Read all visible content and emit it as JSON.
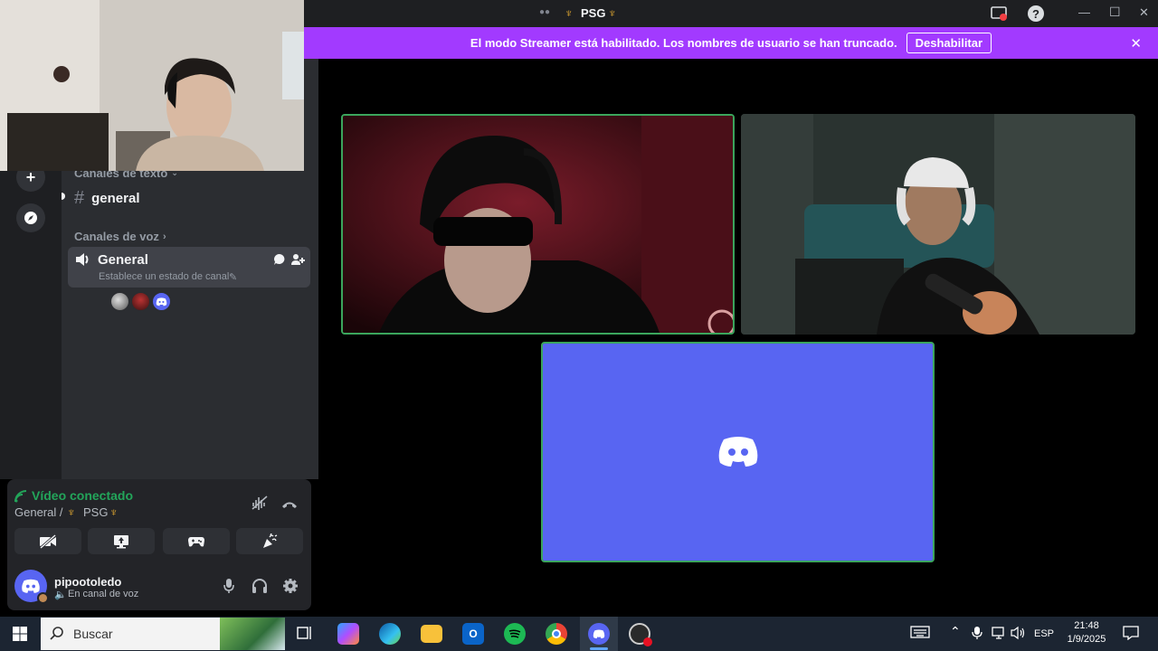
{
  "window": {
    "server_title": "PSG",
    "controls": {
      "minimize": "—",
      "maximize": "☐",
      "close": "✕"
    }
  },
  "banner": {
    "message": "El modo Streamer está habilitado. Los nombres de usuario se han truncado.",
    "button_label": "Deshabilitar"
  },
  "sidebar": {
    "text_category": "Canales de texto",
    "text_channel": "general",
    "voice_category": "Canales de voz",
    "voice_channel": "General",
    "voice_status_placeholder": "Establece un estado de canal"
  },
  "voice_panel": {
    "status": "Vídeo conectado",
    "location_prefix": "General /",
    "location_server": "PSG"
  },
  "user": {
    "name": "pipootoledo",
    "status": "En canal de voz"
  },
  "taskbar": {
    "search_placeholder": "Buscar",
    "language": "ESP",
    "time": "21:48",
    "date": "1/9/2025"
  },
  "colors": {
    "accent": "#5865f2",
    "banner": "#a23aff",
    "speaking": "#3ba55c",
    "connected": "#23a55a"
  }
}
